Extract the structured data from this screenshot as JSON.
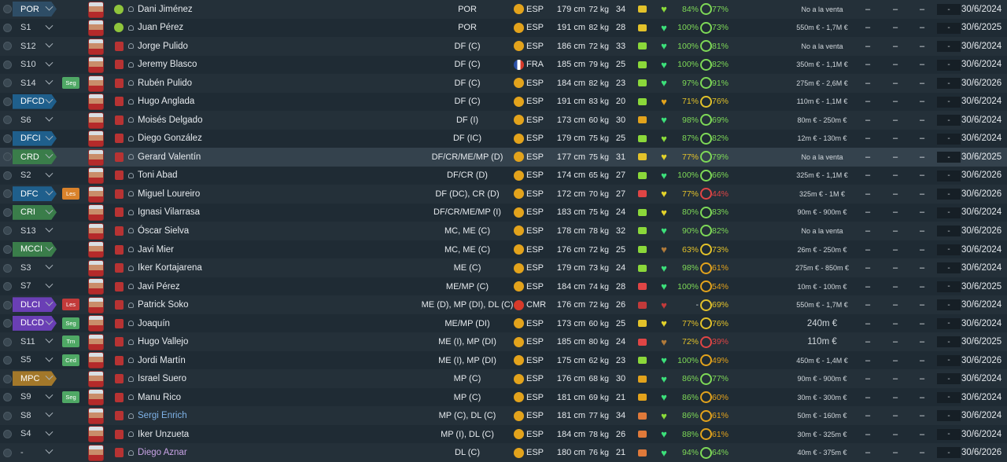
{
  "colors": {
    "kit": "#b73333",
    "ball": "#8fc53c",
    "esp_flag": "#e3a31c",
    "fra_flag": "#2a4fa8",
    "cmr_flag": "#d63a2a"
  },
  "players": [
    {
      "pos": "POR",
      "pos_color": "#2e4d66",
      "status": "",
      "name": "Dani Jiménez",
      "name_color": "white",
      "kit": "ball",
      "role": "POR",
      "nat": "ESP",
      "height": "179 cm",
      "weight": "72 kg",
      "age": "34",
      "cond": "#e3c22a",
      "heart": "#8bdc3a",
      "fit": "84%",
      "ring": "#7ed957",
      "sharp": "77%",
      "value": "No a la venta",
      "value_big": false,
      "d1": "–",
      "d2": "–",
      "d3": "–",
      "d4": "-",
      "expiry": "30/6/2024"
    },
    {
      "pos": "S1",
      "pos_color": "",
      "status": "",
      "name": "Juan Pérez",
      "name_color": "white",
      "kit": "ball",
      "role": "POR",
      "nat": "ESP",
      "height": "191 cm",
      "weight": "82 kg",
      "age": "28",
      "cond": "#e3c22a",
      "heart": "#3ce07a",
      "fit": "100%",
      "ring": "#7ed957",
      "sharp": "73%",
      "value": "550m € - 1,7M €",
      "value_big": false,
      "d1": "–",
      "d2": "–",
      "d3": "–",
      "d4": "-",
      "expiry": "30/6/2025"
    },
    {
      "pos": "S12",
      "pos_color": "",
      "status": "",
      "name": "Jorge Pulido",
      "name_color": "white",
      "kit": "shirt",
      "role": "DF (C)",
      "nat": "ESP",
      "height": "186 cm",
      "weight": "72 kg",
      "age": "33",
      "cond": "#8bd83a",
      "heart": "#3ce07a",
      "fit": "100%",
      "ring": "#7ed957",
      "sharp": "81%",
      "value": "No a la venta",
      "value_big": false,
      "d1": "–",
      "d2": "–",
      "d3": "–",
      "d4": "-",
      "expiry": "30/6/2024"
    },
    {
      "pos": "S10",
      "pos_color": "",
      "status": "",
      "name": "Jeremy Blasco",
      "name_color": "white",
      "kit": "shirt",
      "role": "DF (C)",
      "nat": "FRA",
      "height": "185 cm",
      "weight": "79 kg",
      "age": "25",
      "cond": "#8bd83a",
      "heart": "#3ce07a",
      "fit": "100%",
      "ring": "#7ed957",
      "sharp": "82%",
      "value": "350m € - 1,1M €",
      "value_big": false,
      "d1": "–",
      "d2": "–",
      "d3": "–",
      "d4": "-",
      "expiry": "30/6/2024"
    },
    {
      "pos": "S14",
      "pos_color": "",
      "status": "Seg",
      "status_color": "#4fa865",
      "name": "Rubén Pulido",
      "name_color": "white",
      "kit": "shirt",
      "role": "DF (C)",
      "nat": "ESP",
      "height": "184 cm",
      "weight": "82 kg",
      "age": "23",
      "cond": "#8bd83a",
      "heart": "#3ce07a",
      "fit": "97%",
      "ring": "#7ed957",
      "sharp": "91%",
      "value": "275m € - 2,6M €",
      "value_big": false,
      "d1": "–",
      "d2": "–",
      "d3": "–",
      "d4": "-",
      "expiry": "30/6/2026"
    },
    {
      "pos": "DFCD",
      "pos_color": "#1f5f8c",
      "status": "",
      "name": "Hugo Anglada",
      "name_color": "white",
      "kit": "shirt",
      "role": "DF (C)",
      "nat": "ESP",
      "height": "191 cm",
      "weight": "83 kg",
      "age": "20",
      "cond": "#8bd83a",
      "heart": "#e3a31c",
      "fit": "71%",
      "ring": "#e3c22a",
      "sharp": "76%",
      "value": "110m € - 1,1M €",
      "value_big": false,
      "d1": "–",
      "d2": "–",
      "d3": "–",
      "d4": "-",
      "expiry": "30/6/2024"
    },
    {
      "pos": "S6",
      "pos_color": "",
      "status": "",
      "name": "Moisés Delgado",
      "name_color": "white",
      "kit": "shirt",
      "role": "DF (I)",
      "nat": "ESP",
      "height": "173 cm",
      "weight": "60 kg",
      "age": "30",
      "cond": "#e3a31c",
      "heart": "#3ce07a",
      "fit": "98%",
      "ring": "#7ed957",
      "sharp": "69%",
      "value": "80m € - 250m €",
      "value_big": false,
      "d1": "–",
      "d2": "–",
      "d3": "–",
      "d4": "-",
      "expiry": "30/6/2024"
    },
    {
      "pos": "DFCI",
      "pos_color": "#1f5f8c",
      "status": "",
      "name": "Diego González",
      "name_color": "white",
      "kit": "shirt",
      "role": "DF (IC)",
      "nat": "ESP",
      "height": "179 cm",
      "weight": "75 kg",
      "age": "25",
      "cond": "#8bd83a",
      "heart": "#8bdc3a",
      "fit": "87%",
      "ring": "#7ed957",
      "sharp": "82%",
      "value": "12m € - 130m €",
      "value_big": false,
      "d1": "–",
      "d2": "–",
      "d3": "–",
      "d4": "-",
      "expiry": "30/6/2024"
    },
    {
      "pos": "CRD",
      "pos_color": "#3a7d4a",
      "status": "",
      "name": "Gerard Valentín",
      "name_color": "white",
      "kit": "shirt",
      "role": "DF/CR/ME/MP (D)",
      "nat": "ESP",
      "height": "177 cm",
      "weight": "75 kg",
      "age": "31",
      "cond": "#e3c22a",
      "heart": "#e3d22a",
      "fit": "77%",
      "ring": "#7ed957",
      "sharp": "79%",
      "value": "No a la venta",
      "value_big": false,
      "d1": "–",
      "d2": "–",
      "d3": "–",
      "d4": "-",
      "expiry": "30/6/2025",
      "highlight": true
    },
    {
      "pos": "S2",
      "pos_color": "",
      "status": "",
      "name": "Toni Abad",
      "name_color": "white",
      "kit": "shirt",
      "role": "DF/CR (D)",
      "nat": "ESP",
      "height": "174 cm",
      "weight": "65 kg",
      "age": "27",
      "cond": "#8bd83a",
      "heart": "#3ce07a",
      "fit": "100%",
      "ring": "#7ed957",
      "sharp": "66%",
      "value": "325m € - 1,1M €",
      "value_big": false,
      "d1": "–",
      "d2": "–",
      "d3": "–",
      "d4": "-",
      "expiry": "30/6/2026"
    },
    {
      "pos": "DFC",
      "pos_color": "#1f5f8c",
      "status": "Les",
      "status_color": "#d9822b",
      "name": "Miguel Loureiro",
      "name_color": "white",
      "kit": "shirt",
      "role": "DF (DC), CR (D)",
      "nat": "ESP",
      "height": "172 cm",
      "weight": "70 kg",
      "age": "27",
      "cond": "#e04545",
      "heart": "#e3d22a",
      "fit": "77%",
      "ring": "#e04545",
      "sharp": "44%",
      "value": "325m € - 1M €",
      "value_big": false,
      "d1": "–",
      "d2": "–",
      "d3": "–",
      "d4": "-",
      "expiry": "30/6/2026"
    },
    {
      "pos": "CRI",
      "pos_color": "#3a7d4a",
      "status": "",
      "name": "Ignasi Vilarrasa",
      "name_color": "white",
      "kit": "shirt",
      "role": "DF/CR/ME/MP (I)",
      "nat": "ESP",
      "height": "183 cm",
      "weight": "75 kg",
      "age": "24",
      "cond": "#8bd83a",
      "heart": "#e3d22a",
      "fit": "80%",
      "ring": "#7ed957",
      "sharp": "83%",
      "value": "90m € - 900m €",
      "value_big": false,
      "d1": "–",
      "d2": "–",
      "d3": "–",
      "d4": "-",
      "expiry": "30/6/2024"
    },
    {
      "pos": "S13",
      "pos_color": "",
      "status": "",
      "name": "Óscar Sielva",
      "name_color": "white",
      "kit": "shirt",
      "role": "MC, ME (C)",
      "nat": "ESP",
      "height": "178 cm",
      "weight": "78 kg",
      "age": "32",
      "cond": "#8bd83a",
      "heart": "#3ce07a",
      "fit": "90%",
      "ring": "#7ed957",
      "sharp": "82%",
      "value": "No a la venta",
      "value_big": false,
      "d1": "–",
      "d2": "–",
      "d3": "–",
      "d4": "-",
      "expiry": "30/6/2026"
    },
    {
      "pos": "MCCI",
      "pos_color": "#3a7d4a",
      "status": "",
      "name": "Javi Mier",
      "name_color": "white",
      "kit": "shirt",
      "role": "MC, ME (C)",
      "nat": "ESP",
      "height": "176 cm",
      "weight": "72 kg",
      "age": "25",
      "cond": "#8bd83a",
      "heart": "#b07a3a",
      "fit": "63%",
      "ring": "#e3c22a",
      "sharp": "73%",
      "value": "26m € - 250m €",
      "value_big": false,
      "d1": "–",
      "d2": "–",
      "d3": "–",
      "d4": "-",
      "expiry": "30/6/2024"
    },
    {
      "pos": "S3",
      "pos_color": "",
      "status": "",
      "name": "Iker Kortajarena",
      "name_color": "white",
      "kit": "shirt",
      "role": "ME (C)",
      "nat": "ESP",
      "height": "179 cm",
      "weight": "73 kg",
      "age": "24",
      "cond": "#8bd83a",
      "heart": "#3ce07a",
      "fit": "98%",
      "ring": "#e3a31c",
      "sharp": "61%",
      "value": "275m € - 850m €",
      "value_big": false,
      "d1": "–",
      "d2": "–",
      "d3": "–",
      "d4": "-",
      "expiry": "30/6/2024"
    },
    {
      "pos": "S7",
      "pos_color": "",
      "status": "",
      "name": "Javi Pérez",
      "name_color": "white",
      "kit": "shirt",
      "role": "ME/MP (C)",
      "nat": "ESP",
      "height": "184 cm",
      "weight": "74 kg",
      "age": "28",
      "cond": "#e04545",
      "heart": "#3ce07a",
      "fit": "100%",
      "ring": "#e3a31c",
      "sharp": "54%",
      "value": "10m € - 100m €",
      "value_big": false,
      "d1": "–",
      "d2": "–",
      "d3": "–",
      "d4": "-",
      "expiry": "30/6/2025"
    },
    {
      "pos": "DLCI",
      "pos_color": "#6a3fb5",
      "status": "Les",
      "status_color": "#c23a3a",
      "name": "Patrick Soko",
      "name_color": "white",
      "kit": "shirt",
      "role": "ME (D), MP (DI), DL (C)",
      "nat": "CMR",
      "height": "176 cm",
      "weight": "72 kg",
      "age": "26",
      "cond": "#c23a3a",
      "heart": "#c23a3a",
      "fit": "-",
      "ring": "#e3c22a",
      "sharp": "69%",
      "value": "550m € - 1,7M €",
      "value_big": false,
      "d1": "–",
      "d2": "–",
      "d3": "–",
      "d4": "-",
      "expiry": "30/6/2024"
    },
    {
      "pos": "DLCD",
      "pos_color": "#6a3fb5",
      "status": "Seg",
      "status_color": "#4fa865",
      "name": "Joaquín",
      "name_color": "white",
      "kit": "shirt",
      "role": "ME/MP (DI)",
      "nat": "ESP",
      "height": "173 cm",
      "weight": "60 kg",
      "age": "25",
      "cond": "#e3c22a",
      "heart": "#e3d22a",
      "fit": "77%",
      "ring": "#e3c22a",
      "sharp": "76%",
      "value": "240m €",
      "value_big": true,
      "d1": "–",
      "d2": "–",
      "d3": "–",
      "d4": "-",
      "expiry": "30/6/2024"
    },
    {
      "pos": "S11",
      "pos_color": "",
      "status": "Trn",
      "status_color": "#4fa865",
      "name": "Hugo Vallejo",
      "name_color": "white",
      "kit": "shirt",
      "role": "ME (I), MP (DI)",
      "nat": "ESP",
      "height": "185 cm",
      "weight": "80 kg",
      "age": "24",
      "cond": "#e04545",
      "heart": "#b07a3a",
      "fit": "72%",
      "ring": "#e04545",
      "sharp": "39%",
      "value": "110m €",
      "value_big": true,
      "d1": "–",
      "d2": "–",
      "d3": "–",
      "d4": "-",
      "expiry": "30/6/2025"
    },
    {
      "pos": "S5",
      "pos_color": "",
      "status": "Ced",
      "status_color": "#4fa865",
      "name": "Jordi Martín",
      "name_color": "white",
      "kit": "shirt",
      "role": "ME (I), MP (DI)",
      "nat": "ESP",
      "height": "175 cm",
      "weight": "62 kg",
      "age": "23",
      "cond": "#8bd83a",
      "heart": "#3ce07a",
      "fit": "100%",
      "ring": "#e3a31c",
      "sharp": "49%",
      "value": "450m € - 1,4M €",
      "value_big": false,
      "d1": "–",
      "d2": "–",
      "d3": "–",
      "d4": "-",
      "expiry": "30/6/2026"
    },
    {
      "pos": "MPC",
      "pos_color": "#a3782a",
      "status": "",
      "name": "Israel Suero",
      "name_color": "white",
      "kit": "shirt",
      "role": "MP (C)",
      "nat": "ESP",
      "height": "176 cm",
      "weight": "68 kg",
      "age": "30",
      "cond": "#e3a31c",
      "heart": "#3ce07a",
      "fit": "86%",
      "ring": "#7ed957",
      "sharp": "77%",
      "value": "90m € - 900m €",
      "value_big": false,
      "d1": "–",
      "d2": "–",
      "d3": "–",
      "d4": "-",
      "expiry": "30/6/2024"
    },
    {
      "pos": "S9",
      "pos_color": "",
      "status": "Seg",
      "status_color": "#4fa865",
      "name": "Manu Rico",
      "name_color": "white",
      "kit": "shirt",
      "role": "MP (C)",
      "nat": "ESP",
      "height": "181 cm",
      "weight": "69 kg",
      "age": "21",
      "cond": "#e3a31c",
      "heart": "#3ce07a",
      "fit": "86%",
      "ring": "#e3a31c",
      "sharp": "60%",
      "value": "30m € - 300m €",
      "value_big": false,
      "d1": "–",
      "d2": "–",
      "d3": "–",
      "d4": "-",
      "expiry": "30/6/2024"
    },
    {
      "pos": "S8",
      "pos_color": "",
      "status": "",
      "name": "Sergi Enrich",
      "name_color": "blue",
      "kit": "shirt",
      "role": "MP (C), DL (C)",
      "nat": "ESP",
      "height": "181 cm",
      "weight": "77 kg",
      "age": "34",
      "cond": "#e07a3a",
      "heart": "#8bdc3a",
      "fit": "86%",
      "ring": "#e3a31c",
      "sharp": "61%",
      "value": "50m € - 160m €",
      "value_big": false,
      "d1": "–",
      "d2": "–",
      "d3": "–",
      "d4": "-",
      "expiry": "30/6/2024"
    },
    {
      "pos": "S4",
      "pos_color": "",
      "status": "",
      "name": "Iker Unzueta",
      "name_color": "white",
      "kit": "shirt",
      "role": "MP (I), DL (C)",
      "nat": "ESP",
      "height": "184 cm",
      "weight": "78 kg",
      "age": "26",
      "cond": "#e07a3a",
      "heart": "#3ce07a",
      "fit": "88%",
      "ring": "#e3a31c",
      "sharp": "61%",
      "value": "30m € - 325m €",
      "value_big": false,
      "d1": "–",
      "d2": "–",
      "d3": "–",
      "d4": "-",
      "expiry": "30/6/2024"
    },
    {
      "pos": "-",
      "pos_color": "",
      "status": "",
      "name": "Diego Aznar",
      "name_color": "purple",
      "kit": "shirt",
      "role": "DL (C)",
      "nat": "ESP",
      "height": "180 cm",
      "weight": "76 kg",
      "age": "21",
      "cond": "#e07a3a",
      "heart": "#3ce07a",
      "fit": "94%",
      "ring": "#7ed957",
      "sharp": "64%",
      "value": "40m € - 375m €",
      "value_big": false,
      "d1": "–",
      "d2": "–",
      "d3": "–",
      "d4": "-",
      "expiry": "30/6/2026"
    }
  ]
}
